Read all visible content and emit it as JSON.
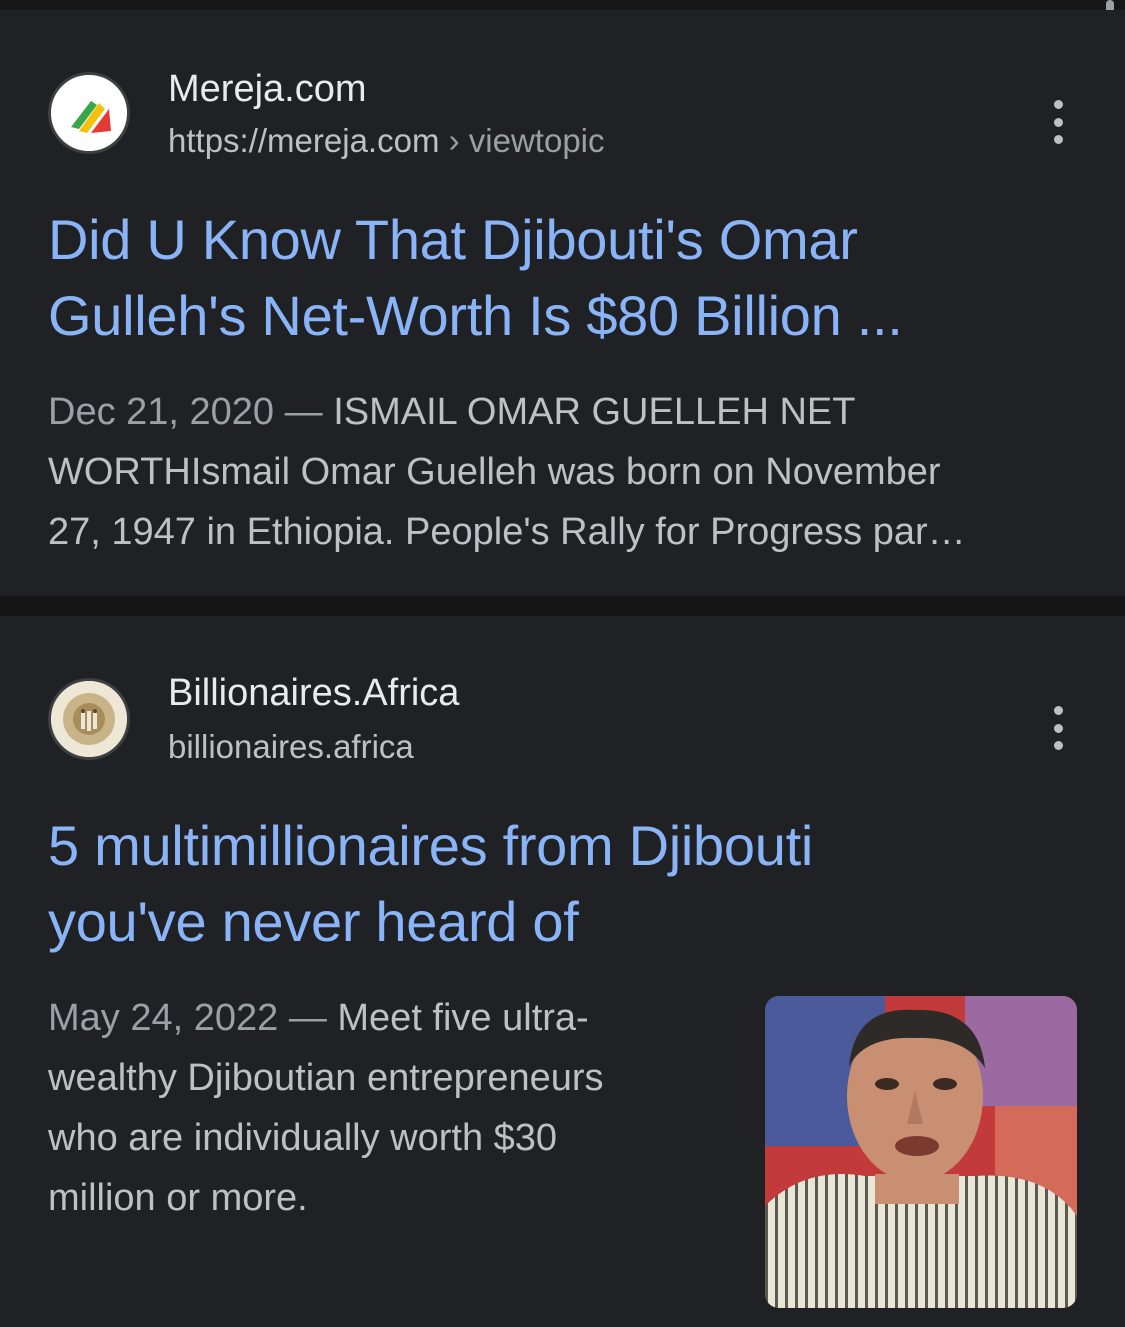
{
  "results": [
    {
      "site_name": "Mereja.com",
      "url_domain": "https://mereja.com",
      "url_separator": "›",
      "url_path": "viewtopic",
      "favicon_icon": "mereja-flag-logo-icon",
      "title_line1": "Did U Know That Djibouti's Omar",
      "title_line2": "Gulleh's Net-Worth Is $80 Billion ...",
      "date": "Dec 21, 2020",
      "dash": "—",
      "snippet_line1": "ISMAIL OMAR GUELLEH NET",
      "snippet_line2": "WORTHIsmail Omar Guelleh was born on November",
      "snippet_line3": "27, 1947 in Ethiopia. People's Rally for Progress par…"
    },
    {
      "site_name": "Billionaires.Africa",
      "url_domain": "billionaires.africa",
      "favicon_icon": "lion-logo-icon",
      "title_line1": "5 multimillionaires from Djibouti",
      "title_line2": "you've never heard of",
      "date": "May 24, 2022",
      "dash": "—",
      "snippet_line1": "Meet five ultra-",
      "snippet_line2": "wealthy Djiboutian entrepreneurs",
      "snippet_line3": "who are individually worth $30",
      "snippet_line4": "million or more.",
      "thumbnail_icon": "portrait-photo-thumbnail"
    }
  ],
  "menu_icon": "more-vert-icon",
  "colors": {
    "background": "#202124",
    "link": "#8ab4f8",
    "text": "#bdc1c6",
    "site_name": "#e8eaed"
  }
}
